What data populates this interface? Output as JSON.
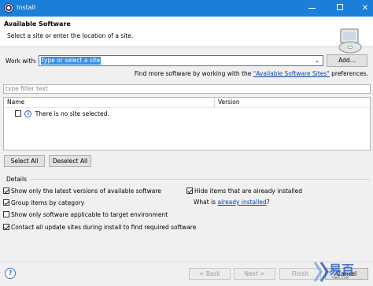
{
  "window": {
    "title": "Install",
    "minimize_icon": "minimize-icon",
    "maximize_icon": "maximize-icon",
    "close_icon": "close-icon"
  },
  "banner": {
    "heading": "Available Software",
    "subtext": "Select a site or enter the location of a site."
  },
  "work_with": {
    "label": "Work with:",
    "value": "type or select a site",
    "add_button": "Add..."
  },
  "more_software": {
    "prefix": "Find more software by working with the ",
    "link": "\"Available Software Sites\"",
    "suffix": " preferences."
  },
  "filter": {
    "placeholder": "type filter text"
  },
  "table": {
    "columns": [
      "Name",
      "Version"
    ],
    "rows": [
      {
        "name": "There is no site selected.",
        "checked": false,
        "icon": "info-icon"
      }
    ]
  },
  "selection_buttons": {
    "select_all": "Select All",
    "deselect_all": "Deselect All"
  },
  "details": {
    "label": "Details",
    "options": [
      {
        "label": "Show only the latest versions of available software",
        "checked": true
      },
      {
        "label": "Group items by category",
        "checked": true
      },
      {
        "label": "Show only software applicable to target environment",
        "checked": false
      },
      {
        "label": "Contact all update sites during install to find required software",
        "checked": true
      }
    ],
    "hide_installed": {
      "label": "Hide items that are already installed",
      "checked": true
    },
    "what_is": {
      "prefix": "What is ",
      "link": "already installed",
      "suffix": "?"
    }
  },
  "footer": {
    "help": "?",
    "back": "< Back",
    "next": "Next >",
    "finish": "Finish",
    "cancel": "Cancel"
  },
  "watermark": {
    "text": "易百",
    "subtext": "YIIBAI.COM"
  },
  "colors": {
    "titlebar": "#1a7fd8",
    "link": "#0645ad",
    "selection": "#3a8ee6"
  }
}
